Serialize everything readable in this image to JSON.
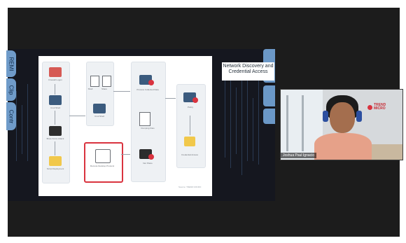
{
  "side_tabs": [
    {
      "label": "REMI"
    },
    {
      "label": "Clip"
    },
    {
      "label": "Contr"
    }
  ],
  "slide": {
    "banner_text": "Network Discovery and Credential Access",
    "footer_text": "Source: TREND MICRO",
    "labels": {
      "n1": "Firewall Logon",
      "n2": "Cmd Shell",
      "n3": "Brute Force Attack",
      "n4": "Script Deployment",
      "n5": "Shell",
      "n6": "Share",
      "n7": "Cmd Shell",
      "n8": "Remote Desktop Protocol",
      "n9": "Process Collected Data",
      "n10": "Dumping Files",
      "n11": "Net Share",
      "n12": "Policy",
      "n13": "Credential Access"
    }
  },
  "video": {
    "speaker_name": "Joshua Paul Ignacio",
    "brand": "TREND MICRO"
  },
  "colors": {
    "accent_red": "#d9333f",
    "tab_blue": "#6f9bc9",
    "dark_bg": "#1c1c1c"
  }
}
